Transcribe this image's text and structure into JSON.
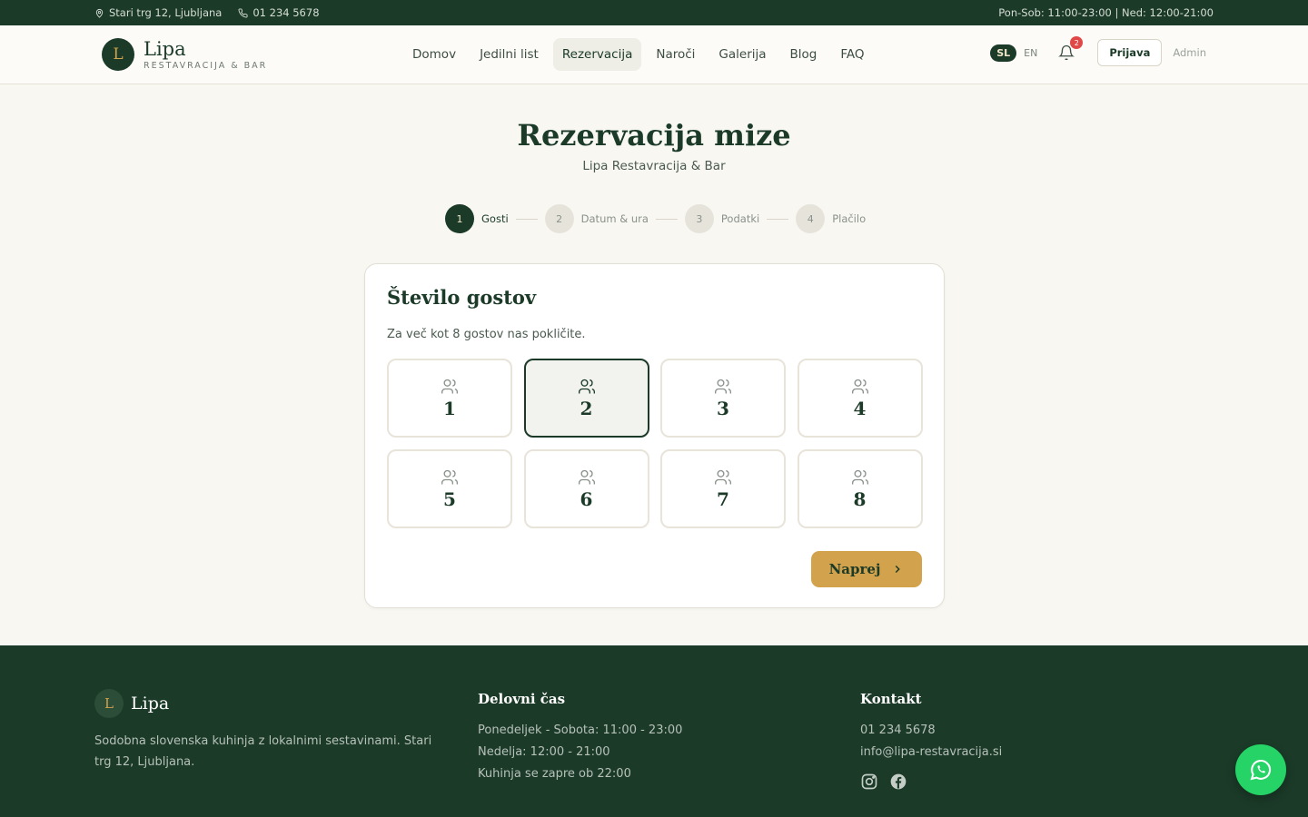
{
  "topbar": {
    "address": "Stari trg 12, Ljubljana",
    "phone": "01 234 5678",
    "hours": "Pon-Sob: 11:00-23:00 | Ned: 12:00-21:00"
  },
  "brand": {
    "initial": "L",
    "name": "Lipa",
    "subtitle": "RESTAVRACIJA & BAR"
  },
  "nav": {
    "items": [
      {
        "label": "Domov"
      },
      {
        "label": "Jedilni list"
      },
      {
        "label": "Rezervacija"
      },
      {
        "label": "Naroči"
      },
      {
        "label": "Galerija"
      },
      {
        "label": "Blog"
      },
      {
        "label": "FAQ"
      }
    ],
    "active": "Rezervacija",
    "lang_sl": "SL",
    "lang_en": "EN",
    "notifications": "2",
    "login": "Prijava",
    "admin": "Admin"
  },
  "page": {
    "title": "Rezervacija mize",
    "subtitle": "Lipa Restavracija & Bar"
  },
  "steps": [
    {
      "num": "1",
      "label": "Gosti"
    },
    {
      "num": "2",
      "label": "Datum & ura"
    },
    {
      "num": "3",
      "label": "Podatki"
    },
    {
      "num": "4",
      "label": "Plačilo"
    }
  ],
  "active_step": "1",
  "guests": {
    "title": "Število gostov",
    "hint": "Za več kot 8 gostov nas pokličite.",
    "options": [
      "1",
      "2",
      "3",
      "4",
      "5",
      "6",
      "7",
      "8"
    ],
    "selected": "2",
    "next": "Naprej"
  },
  "footer": {
    "initial": "L",
    "name": "Lipa",
    "description": "Sodobna slovenska kuhinja z lokalnimi sestavinami. Stari trg 12, Ljubljana.",
    "hours_title": "Delovni čas",
    "hours": [
      "Ponedeljek - Sobota: 11:00 - 23:00",
      "Nedelja: 12:00 - 21:00",
      "Kuhinja se zapre ob 22:00"
    ],
    "contact_title": "Kontakt",
    "phone": "01 234 5678",
    "email": "info@lipa-restavracija.si"
  },
  "colors": {
    "primary": "#1b3a28",
    "accent": "#d2a24c",
    "whatsapp": "#25d366"
  }
}
